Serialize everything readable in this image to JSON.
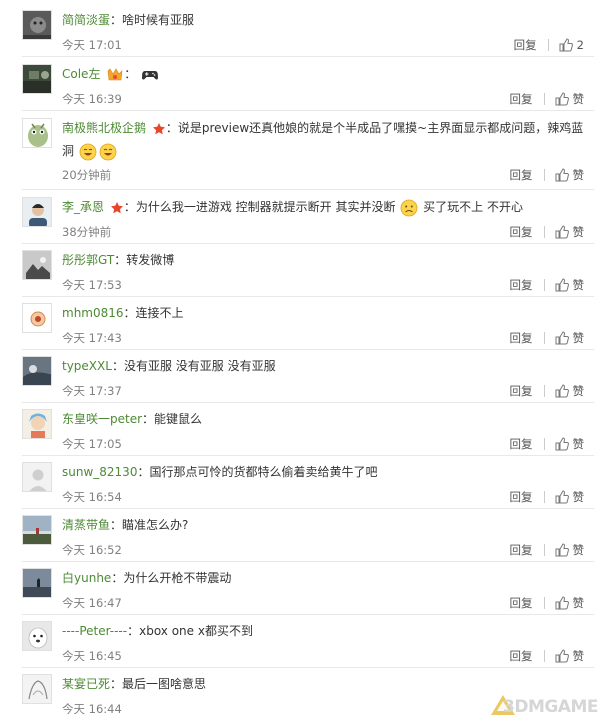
{
  "labels": {
    "reply": "回复",
    "like": "赞"
  },
  "comments": [
    {
      "user": "简简淡蛋",
      "text": "啥时候有亚服",
      "time": "今天 17:01",
      "likes": "2"
    },
    {
      "user": "Cole左",
      "text": "",
      "time": "今天 16:39",
      "likes": "赞"
    },
    {
      "user": "南极熊北极企鹅",
      "text": "说是preview还真他娘的就是个半成品了嘿摸~主界面显示都成问题，辣鸡蓝",
      "text2": "洞",
      "time": "20分钟前",
      "likes": "赞"
    },
    {
      "user": "李_承恩",
      "text": "为什么我一进游戏 控制器就提示断开 其实并没断",
      "text_after": "买了玩不上 不开心",
      "time": "38分钟前",
      "likes": "赞"
    },
    {
      "user": "彤彤郭GT",
      "text": "转发微博",
      "time": "今天 17:53",
      "likes": "赞"
    },
    {
      "user": "mhm0816",
      "text": "连接不上",
      "time": "今天 17:43",
      "likes": "赞"
    },
    {
      "user": "typeXXL",
      "text": "没有亚服 没有亚服 没有亚服",
      "time": "今天 17:37",
      "likes": "赞"
    },
    {
      "user": "东皇咲一peter",
      "text": "能键鼠么",
      "time": "今天 17:05",
      "likes": "赞"
    },
    {
      "user": "sunw_82130",
      "text": "国行那点可怜的货都特么偷着卖给黄牛了吧",
      "time": "今天 16:54",
      "likes": "赞"
    },
    {
      "user": "清蒸带鱼",
      "text": "瞄准怎么办?",
      "time": "今天 16:52",
      "likes": "赞"
    },
    {
      "user": "白yunhe",
      "text": "为什么开枪不带震动",
      "time": "今天 16:47",
      "likes": "赞"
    },
    {
      "user": "----Peter----",
      "text": "xbox one x都买不到",
      "time": "今天 16:45",
      "likes": "赞"
    },
    {
      "user": "某宴已死",
      "text": "最后一图啥意思",
      "time": "今天 16:44",
      "likes": "赞"
    }
  ],
  "watermark": "3DMGAME",
  "colors": {
    "username": "#4d8a34",
    "meta": "#808080",
    "divider": "#e8e8e8"
  }
}
